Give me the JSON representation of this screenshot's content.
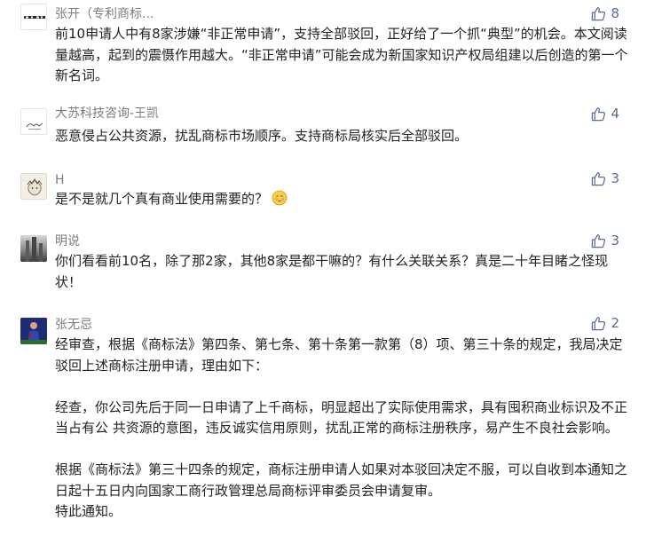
{
  "comments": [
    {
      "nickname": "张开（专利商标...",
      "likes": "8",
      "text": "前10申请人中有8家涉嫌“非正常申请”，支持全部驳回，正好给了一个抓“典型”的机会。本文阅读量越高，起到的震慑作用越大。“非正常申请”可能会成为新国家知识产权局组建以后创造的第一个新名词。"
    },
    {
      "nickname": "大苏科技咨询-王凯",
      "likes": "4",
      "text": "恶意侵占公共资源，扰乱商标市场顺序。支持商标局核实后全部驳回。"
    },
    {
      "nickname": "H",
      "likes": "3",
      "text": "是不是就几个真有商业使用需要的？"
    },
    {
      "nickname": "明说",
      "likes": "3",
      "text": "你们看看前10名，除了那2家，其他8家是都干嘛的？有什么关联关系？真是二十年目睹之怪现状！"
    },
    {
      "nickname": "张无忌",
      "likes": "2",
      "paragraphs": [
        "经审查，根据《商标法》第四条、第七条、第十条第一款第（8）项、第三十条的规定，我局决定驳回上述商标注册申请，理由如下：",
        "经查，你公司先后于同一日申请了上千商标，明显超出了实际使用需求，具有囤积商业标识及不正当占有公 共资源的意图，违反诚实信用原则，扰乱正常的商标注册秩序，易产生不良社会影响。",
        "根据《商标法》第三十四条的规定，商标注册申请人如果对本驳回决定不服，可以自收到本通知之日起十五日内向国家工商行政管理总局商标评审委员会申请复审。",
        "特此通知。"
      ]
    }
  ],
  "icons": {
    "like": "thumbs-up-icon",
    "emoji": "shy-face-emoji-icon"
  },
  "colors": {
    "nickname": "#7d7d7d",
    "like": "#576b95",
    "text": "#222222"
  }
}
